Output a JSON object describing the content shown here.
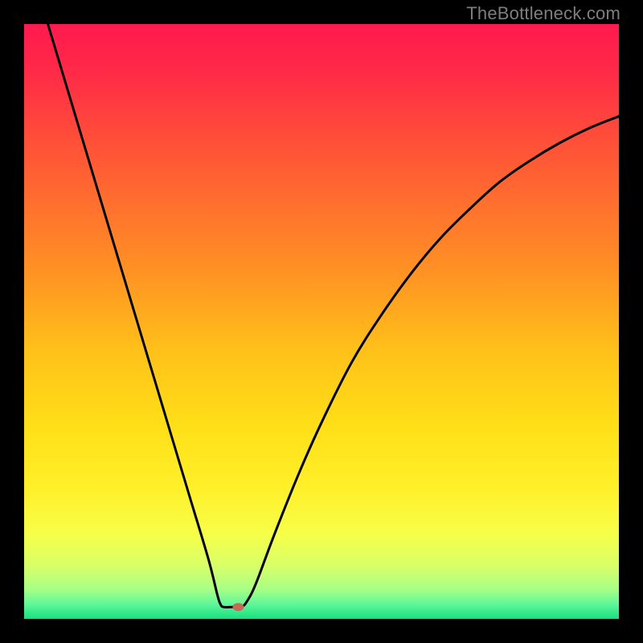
{
  "watermark": "TheBottleneck.com",
  "chart_data": {
    "type": "line",
    "title": "",
    "xlabel": "",
    "ylabel": "",
    "xlim": [
      0,
      100
    ],
    "ylim": [
      0,
      100
    ],
    "grid": false,
    "curve_points": [
      {
        "x": 4.0,
        "y": 100.0
      },
      {
        "x": 7.0,
        "y": 90.0
      },
      {
        "x": 10.0,
        "y": 80.0
      },
      {
        "x": 13.0,
        "y": 70.0
      },
      {
        "x": 16.0,
        "y": 60.0
      },
      {
        "x": 19.0,
        "y": 50.0
      },
      {
        "x": 22.0,
        "y": 40.0
      },
      {
        "x": 25.0,
        "y": 30.0
      },
      {
        "x": 28.0,
        "y": 20.0
      },
      {
        "x": 31.0,
        "y": 10.0
      },
      {
        "x": 32.5,
        "y": 4.0
      },
      {
        "x": 33.0,
        "y": 2.5
      },
      {
        "x": 33.5,
        "y": 2.0
      },
      {
        "x": 35.0,
        "y": 2.0
      },
      {
        "x": 36.5,
        "y": 2.0
      },
      {
        "x": 37.5,
        "y": 3.0
      },
      {
        "x": 39.0,
        "y": 6.0
      },
      {
        "x": 42.0,
        "y": 14.0
      },
      {
        "x": 46.0,
        "y": 24.0
      },
      {
        "x": 50.0,
        "y": 33.0
      },
      {
        "x": 55.0,
        "y": 43.0
      },
      {
        "x": 60.0,
        "y": 51.0
      },
      {
        "x": 65.0,
        "y": 58.0
      },
      {
        "x": 70.0,
        "y": 64.0
      },
      {
        "x": 75.0,
        "y": 69.0
      },
      {
        "x": 80.0,
        "y": 73.5
      },
      {
        "x": 85.0,
        "y": 77.0
      },
      {
        "x": 90.0,
        "y": 80.0
      },
      {
        "x": 95.0,
        "y": 82.5
      },
      {
        "x": 100.0,
        "y": 84.5
      }
    ],
    "marker": {
      "x": 36.0,
      "y": 2.0,
      "color": "#cc6655"
    },
    "gradient_stops": [
      {
        "offset": 0.0,
        "color": "#ff1a4f"
      },
      {
        "offset": 0.08,
        "color": "#ff2a47"
      },
      {
        "offset": 0.18,
        "color": "#ff4a3a"
      },
      {
        "offset": 0.3,
        "color": "#ff6f2e"
      },
      {
        "offset": 0.42,
        "color": "#ff9323"
      },
      {
        "offset": 0.55,
        "color": "#ffc119"
      },
      {
        "offset": 0.68,
        "color": "#ffe018"
      },
      {
        "offset": 0.78,
        "color": "#fff02a"
      },
      {
        "offset": 0.86,
        "color": "#f6ff4a"
      },
      {
        "offset": 0.91,
        "color": "#d8ff68"
      },
      {
        "offset": 0.95,
        "color": "#a8ff85"
      },
      {
        "offset": 0.975,
        "color": "#60f79a"
      },
      {
        "offset": 1.0,
        "color": "#16e07f"
      }
    ],
    "curve_stroke": "#000000",
    "curve_width": 3
  }
}
